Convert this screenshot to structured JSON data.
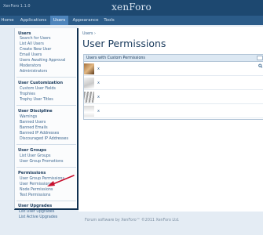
{
  "header": {
    "version": "XenForo 1.1.0",
    "logo": "xenForo"
  },
  "nav": {
    "tabs": [
      {
        "label": "Home",
        "active": false
      },
      {
        "label": "Applications",
        "active": false
      },
      {
        "label": "Users",
        "active": true
      },
      {
        "label": "Appearance",
        "active": false
      },
      {
        "label": "Tools",
        "active": false
      }
    ]
  },
  "sidebar": {
    "users": {
      "heading": "Users",
      "items": [
        "Search for Users",
        "List All Users",
        "Create New User",
        "Email Users",
        "Users Awaiting Approval",
        "Moderators",
        "Administrators"
      ]
    },
    "customization": {
      "heading": "User Customization",
      "items": [
        "Custom User Fields",
        "Trophies",
        "Trophy User Titles"
      ]
    },
    "discipline": {
      "heading": "User Discipline",
      "items": [
        "Warnings",
        "Banned Users",
        "Banned Emails",
        "Banned IP Addresses",
        "Discouraged IP Addresses"
      ]
    },
    "groups": {
      "heading": "User Groups",
      "items": [
        "List User Groups",
        "User Group Promotions"
      ]
    },
    "permissions": {
      "heading": "Permissions",
      "items": [
        "User Group Permissions",
        "User Permissions",
        "Node Permissions",
        "Test Permissions"
      ]
    },
    "upgrades": {
      "heading": "User Upgrades",
      "items": [
        "List User Upgrades",
        "List Active Upgrades"
      ]
    }
  },
  "main": {
    "breadcrumb": "Users ›",
    "title": "User Permissions",
    "panel": {
      "heading": "Users with Custom Permissions",
      "search_icon": "magnifier-icon",
      "rows": [
        "x",
        "x",
        "x",
        "x"
      ]
    }
  },
  "footer": {
    "text": "Forum software by XenForo™ ©2011 XenForo Ltd."
  },
  "colors": {
    "header": "#1d4870",
    "navbar": "#2b5b88",
    "active_tab": "#4d84bb",
    "annotation_arrow": "#c8102e"
  }
}
